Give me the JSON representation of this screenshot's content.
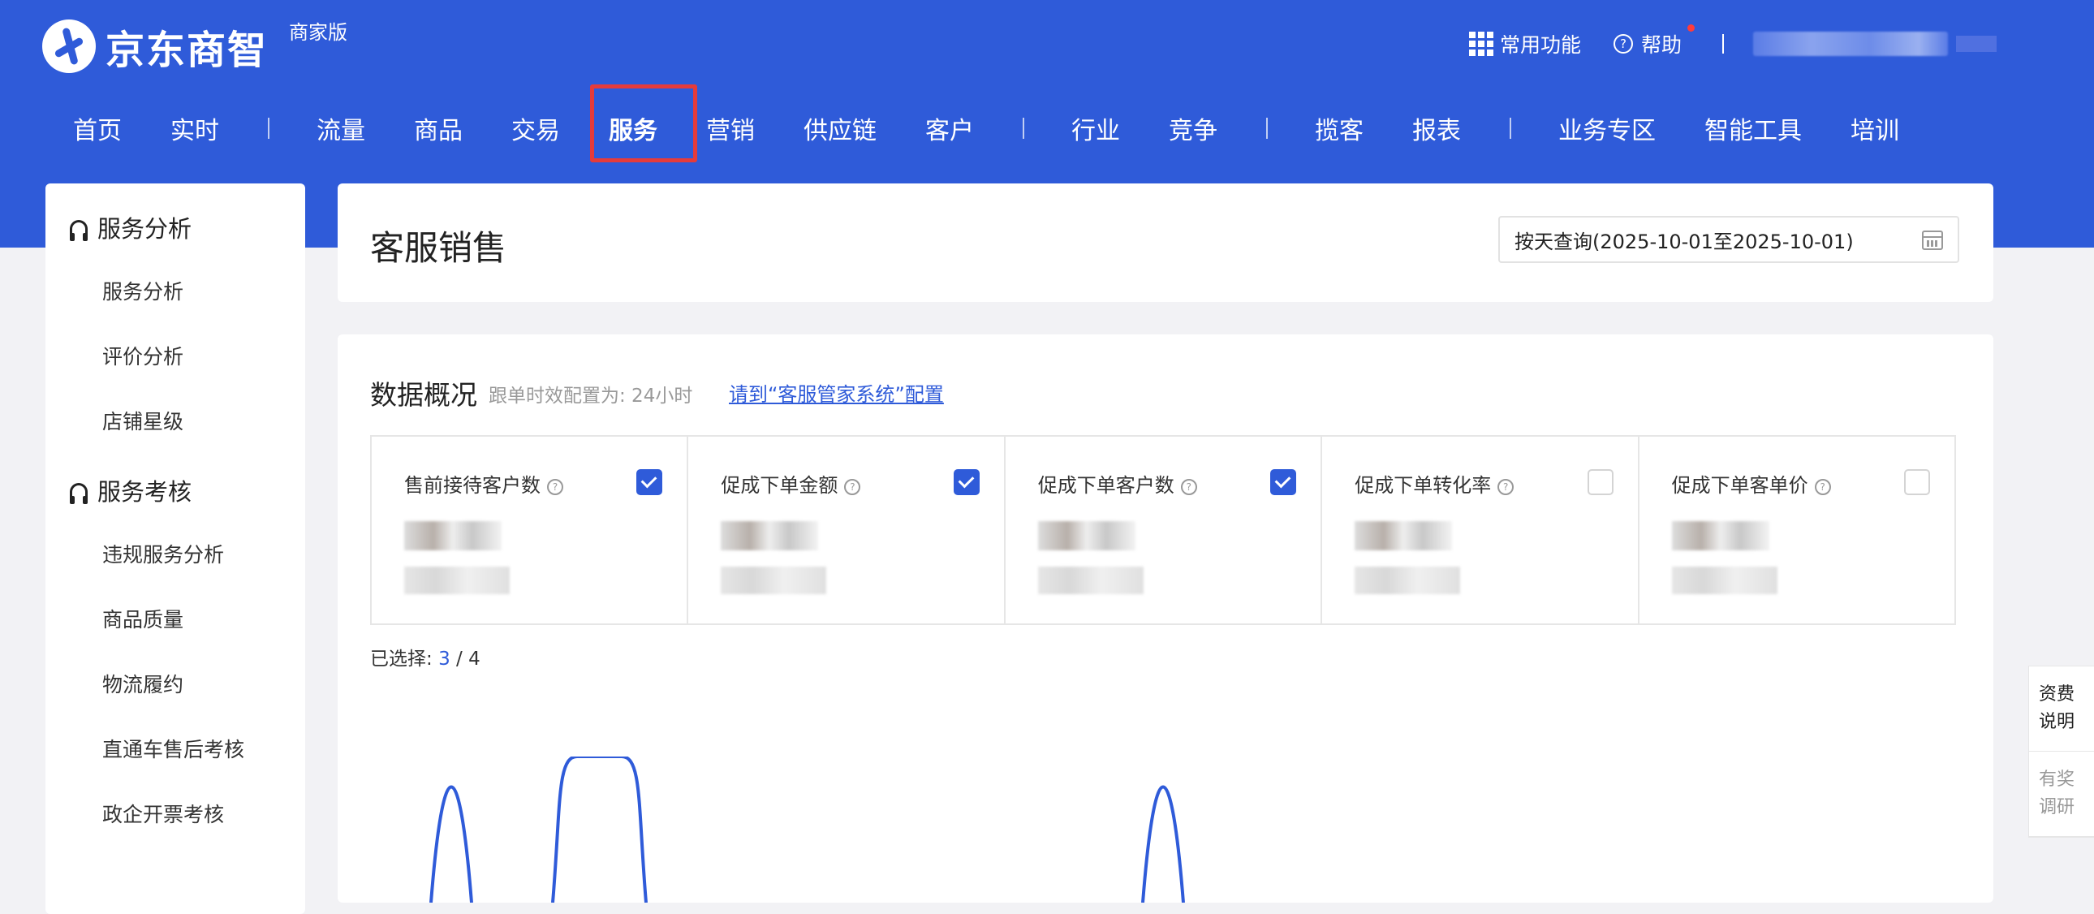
{
  "header": {
    "logo_text": "京东商智",
    "edition": "商家版",
    "favorites_label": "常用功能",
    "help_label": "帮助",
    "help_icon_glyph": "?",
    "help_badge_color": "#ff3b3b"
  },
  "colors": {
    "primary": "#2f5bd9",
    "highlight_border": "#e53b3b"
  },
  "nav": {
    "items": [
      {
        "label": "首页"
      },
      {
        "label": "实时"
      },
      {
        "label": "流量"
      },
      {
        "label": "商品"
      },
      {
        "label": "交易"
      },
      {
        "label": "服务",
        "active": true
      },
      {
        "label": "营销"
      },
      {
        "label": "供应链"
      },
      {
        "label": "客户"
      },
      {
        "label": "行业"
      },
      {
        "label": "竞争"
      },
      {
        "label": "揽客"
      },
      {
        "label": "报表"
      },
      {
        "label": "业务专区"
      },
      {
        "label": "智能工具"
      },
      {
        "label": "培训"
      }
    ]
  },
  "sidebar": {
    "groups": [
      {
        "title": "服务分析",
        "icon": "headphones-icon",
        "items": [
          "服务分析",
          "评价分析",
          "店铺星级"
        ]
      },
      {
        "title": "服务考核",
        "icon": "headphones-icon",
        "items": [
          "违规服务分析",
          "商品质量",
          "物流履约",
          "直通车售后考核",
          "政企开票考核"
        ]
      }
    ]
  },
  "page": {
    "title": "客服销售",
    "date_range": "按天查询(2025-10-01至2025-10-01)"
  },
  "overview": {
    "title": "数据概况",
    "subtitle": "跟单时效配置为: 24小时",
    "config_link": "请到“客服管家系统”配置",
    "metrics": [
      {
        "label": "售前接待客户数",
        "checked": true
      },
      {
        "label": "促成下单金额",
        "checked": true
      },
      {
        "label": "促成下单客户数",
        "checked": true
      },
      {
        "label": "促成下单转化率",
        "checked": false
      },
      {
        "label": "促成下单客单价",
        "checked": false
      }
    ],
    "selected_prefix": "已选择: ",
    "selected_count": "3",
    "selected_total": " / 4"
  },
  "float_tabs": [
    "资费说明",
    "有奖调研"
  ]
}
